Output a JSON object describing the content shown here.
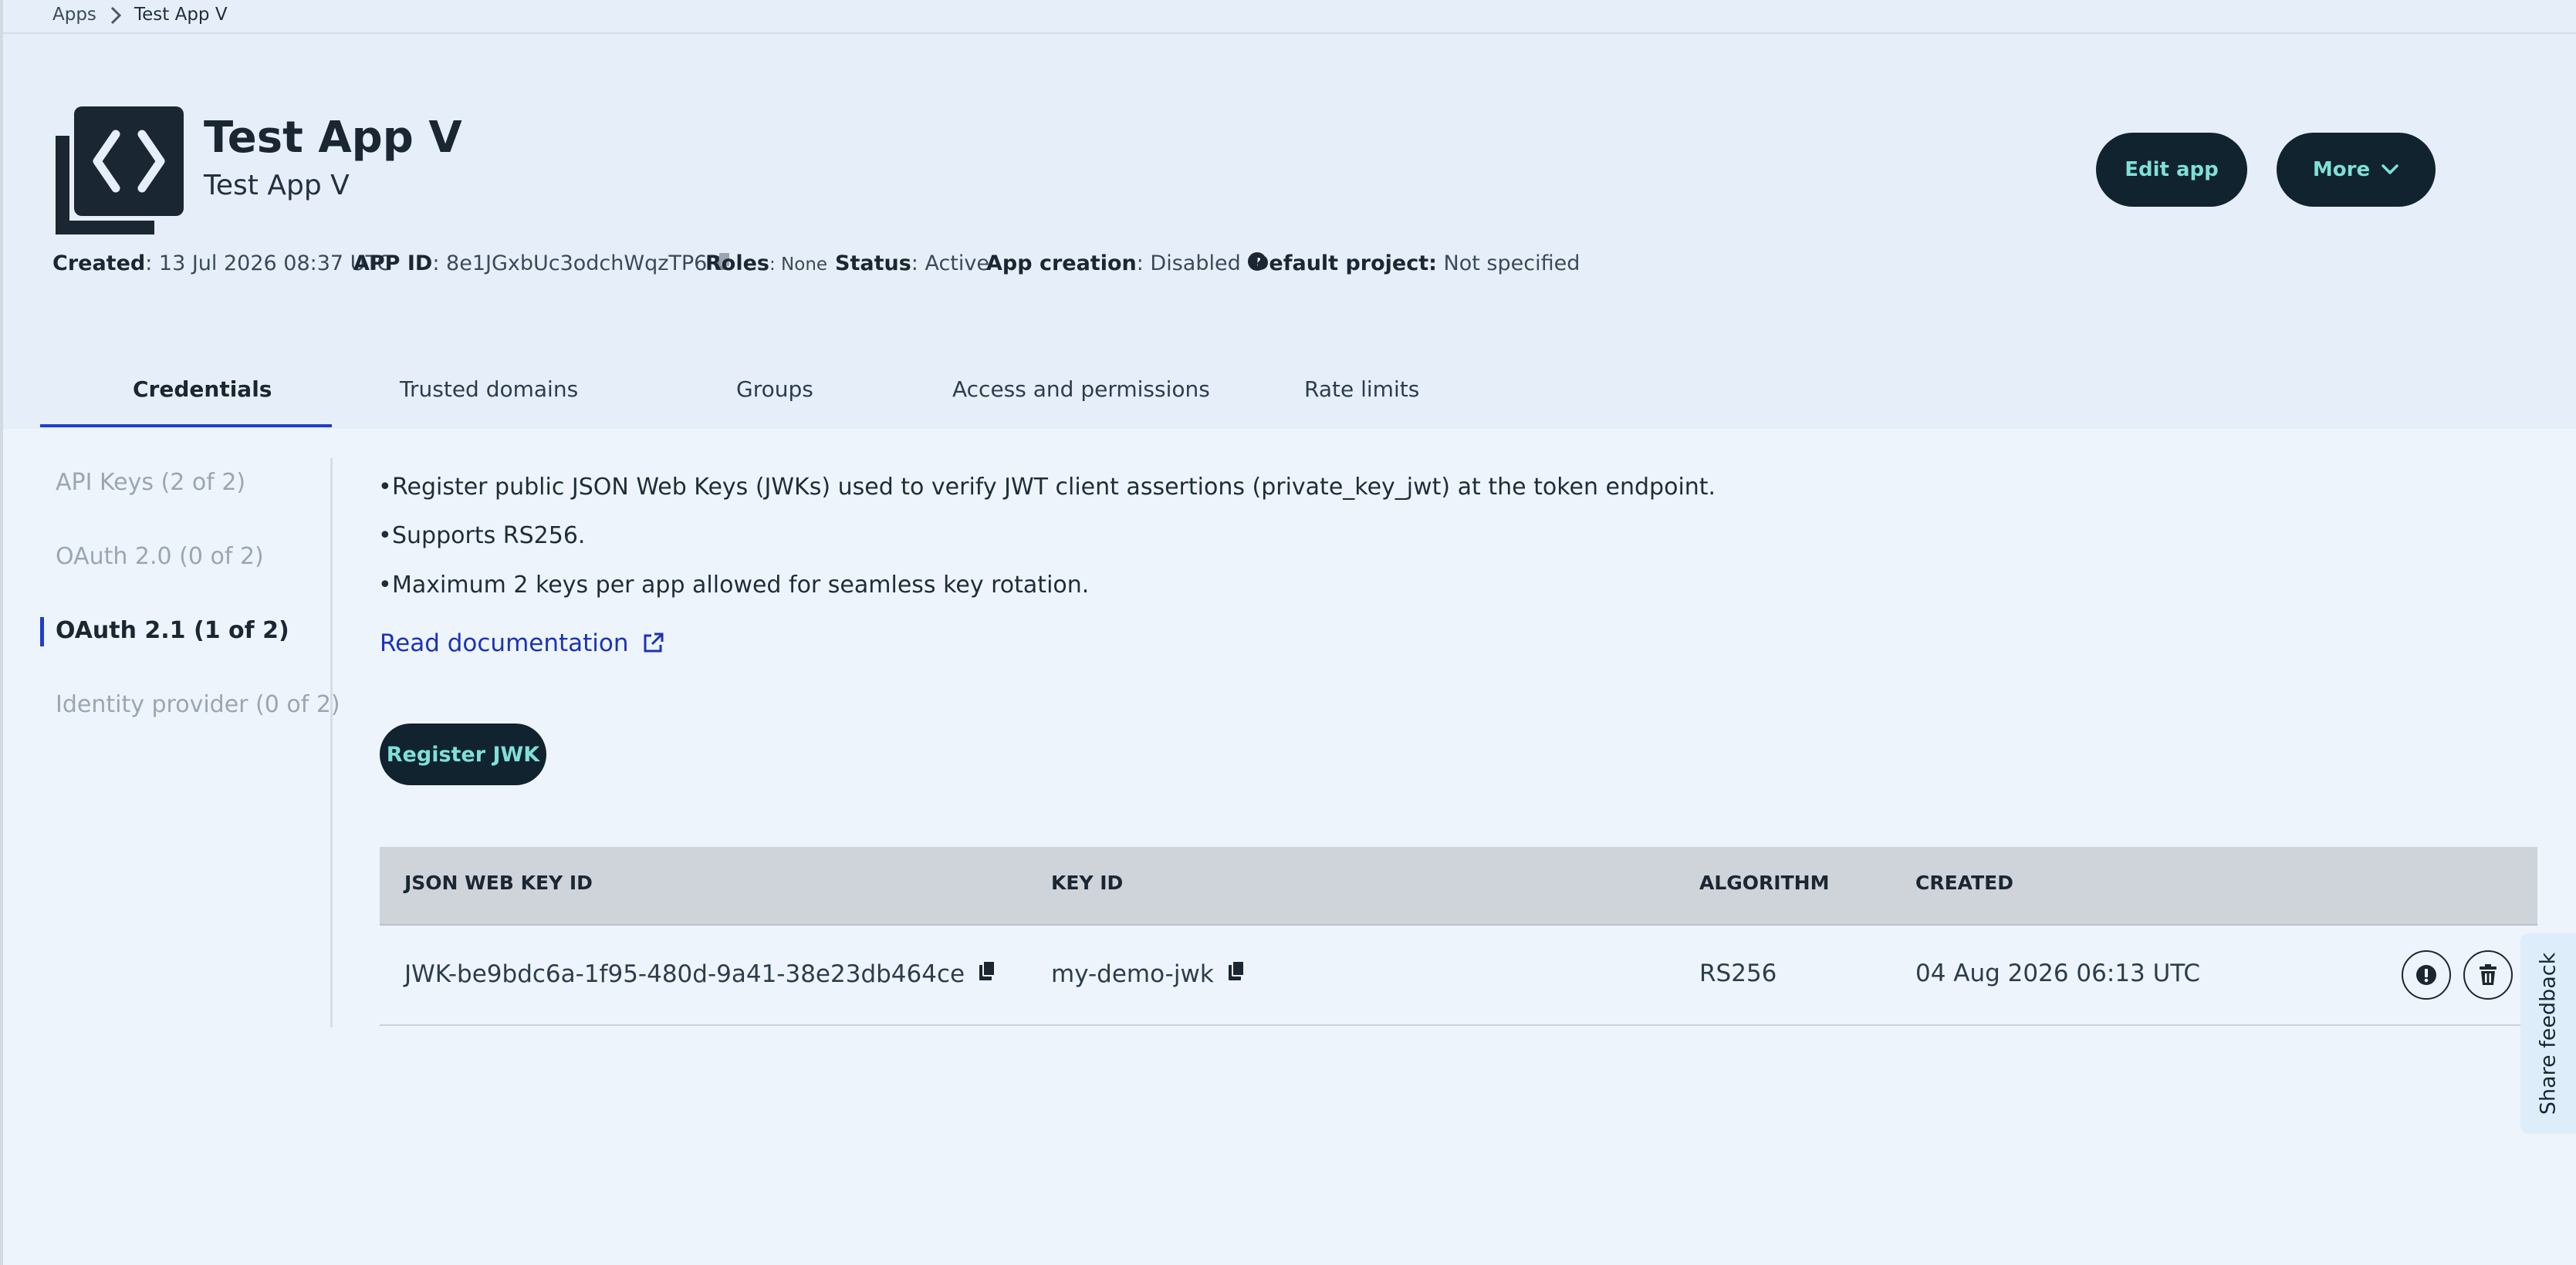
{
  "breadcrumb": {
    "root": "Apps",
    "current": "Test App V"
  },
  "app": {
    "title": "Test App V",
    "subtitle": "Test App V",
    "created_label": "Created",
    "created_value": ": 13 Jul 2026 08:37 UTC",
    "app_id_label": "APP ID",
    "app_id_value": ": 8e1JGxbUc3odchWqzTP6",
    "roles_label": "Roles",
    "roles_value": ": None",
    "status_label": "Status",
    "status_value": ": Active",
    "app_creation_label": "App creation",
    "app_creation_value": ": Disabled",
    "default_project_label": "Default project:",
    "default_project_value": "Not specified"
  },
  "actions": {
    "edit_label": "Edit app",
    "more_label": "More"
  },
  "tabs": [
    {
      "label": "Credentials",
      "active": true
    },
    {
      "label": "Trusted domains"
    },
    {
      "label": "Groups"
    },
    {
      "label": "Access and permissions"
    },
    {
      "label": "Rate limits"
    }
  ],
  "sidebar": {
    "items": [
      {
        "label": "API Keys (2 of 2)"
      },
      {
        "label": "OAuth 2.0 (0 of 2)"
      },
      {
        "label": "OAuth 2.1 (1 of 2)",
        "active": true
      },
      {
        "label": "Identity provider (0 of 2)"
      }
    ]
  },
  "content": {
    "bullets": [
      "Register public JSON Web Keys (JWKs) used to verify JWT client assertions (private_key_jwt) at the token endpoint.",
      "Supports RS256.",
      "Maximum 2 keys per app allowed for seamless key rotation."
    ],
    "doc_link": "Read documentation",
    "register_label": "Register JWK"
  },
  "table": {
    "headers": [
      "JSON WEB KEY ID",
      "KEY ID",
      "ALGORITHM",
      "CREATED"
    ],
    "rows": [
      {
        "jwk_id": "JWK-be9bdc6a-1f95-480d-9a41-38e23db464ce",
        "key_id": "my-demo-jwk",
        "algorithm": "RS256",
        "created": "04 Aug 2026 06:13 UTC"
      }
    ]
  },
  "feedback": {
    "label": "Share feedback"
  },
  "icons": {
    "crumb_separator": "chevron-right-icon",
    "app_logo": "code-brackets-icon",
    "copy": "clipboard-icon",
    "help": "question-circle-icon",
    "more": "chevron-down-icon",
    "external": "external-link-icon",
    "info": "exclamation-circle-icon",
    "delete": "trash-icon"
  },
  "colors": {
    "header_bg": "#e6eef9",
    "page_bg": "#eef4fb",
    "dark_button": "#10232e",
    "button_text": "#7fe0d8",
    "accent": "#1e3fc7",
    "link": "#1a33b8",
    "table_header": "#cfd3da"
  }
}
